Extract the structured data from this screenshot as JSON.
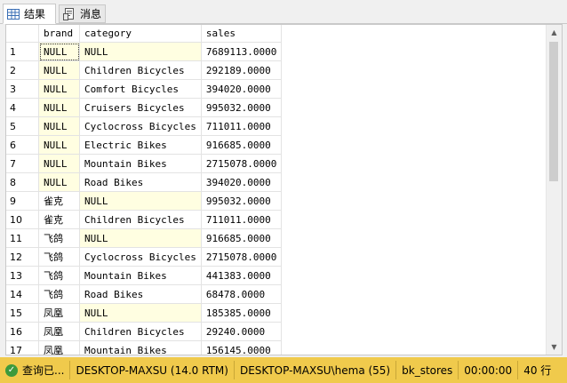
{
  "tabs": [
    {
      "label": "结果",
      "icon": "grid-icon"
    },
    {
      "label": "消息",
      "icon": "messages-icon"
    }
  ],
  "columns": [
    "brand",
    "category",
    "sales"
  ],
  "rows": [
    {
      "num": "1",
      "brand": "NULL",
      "category": "NULL",
      "sales": "7689113.0000"
    },
    {
      "num": "2",
      "brand": "NULL",
      "category": "Children Bicycles",
      "sales": "292189.0000"
    },
    {
      "num": "3",
      "brand": "NULL",
      "category": "Comfort Bicycles",
      "sales": "394020.0000"
    },
    {
      "num": "4",
      "brand": "NULL",
      "category": "Cruisers Bicycles",
      "sales": "995032.0000"
    },
    {
      "num": "5",
      "brand": "NULL",
      "category": "Cyclocross Bicycles",
      "sales": "711011.0000"
    },
    {
      "num": "6",
      "brand": "NULL",
      "category": "Electric Bikes",
      "sales": "916685.0000"
    },
    {
      "num": "7",
      "brand": "NULL",
      "category": "Mountain Bikes",
      "sales": "2715078.0000"
    },
    {
      "num": "8",
      "brand": "NULL",
      "category": "Road Bikes",
      "sales": "394020.0000"
    },
    {
      "num": "9",
      "brand": "雀克",
      "category": "NULL",
      "sales": "995032.0000"
    },
    {
      "num": "10",
      "brand": "雀克",
      "category": "Children Bicycles",
      "sales": "711011.0000"
    },
    {
      "num": "11",
      "brand": "飞鸽",
      "category": "NULL",
      "sales": "916685.0000"
    },
    {
      "num": "12",
      "brand": "飞鸽",
      "category": "Cyclocross Bicycles",
      "sales": "2715078.0000"
    },
    {
      "num": "13",
      "brand": "飞鸽",
      "category": "Mountain Bikes",
      "sales": "441383.0000"
    },
    {
      "num": "14",
      "brand": "飞鸽",
      "category": "Road Bikes",
      "sales": "68478.0000"
    },
    {
      "num": "15",
      "brand": "凤凰",
      "category": "NULL",
      "sales": "185385.0000"
    },
    {
      "num": "16",
      "brand": "凤凰",
      "category": "Children Bicycles",
      "sales": "29240.0000"
    },
    {
      "num": "17",
      "brand": "凤凰",
      "category": "Mountain Bikes",
      "sales": "156145.0000"
    }
  ],
  "status": {
    "query": "查询已...",
    "server": "DESKTOP-MAXSU (14.0 RTM)",
    "user": "DESKTOP-MAXSU\\hema (55)",
    "database": "bk_stores",
    "elapsed": "00:00:00",
    "rows": "40 行",
    "icon": "success-check-icon",
    "color": "#f0ca4c"
  }
}
